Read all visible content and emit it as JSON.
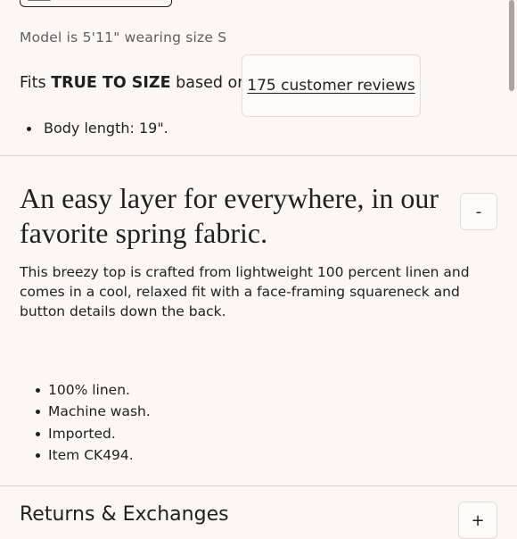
{
  "size_section": {
    "model_note": "Model is 5'11\" wearing size S",
    "fit_prefix": "Fits",
    "fit_value": "TRUE TO SIZE",
    "fit_middle": "based on",
    "reviews_link": "175 customer reviews",
    "details": [
      "Body length: 19\"."
    ]
  },
  "description_section": {
    "title": "An easy layer for everywhere, in our favorite spring fabric.",
    "toggle_label": "-",
    "body": "This breezy top is crafted from lightweight 100 percent linen and comes in a cool, relaxed fit with a face-framing squareneck and button details down the back.",
    "features": [
      "100% linen.",
      "Machine wash.",
      "Imported.",
      "Item CK494."
    ]
  },
  "returns_section": {
    "title": "Returns & Exchanges",
    "toggle_label": "+"
  },
  "icons": {
    "size_chip": "ruler-icon"
  },
  "colors": {
    "background": "#fcf7f3",
    "text": "#1f1f1f",
    "muted_text": "#5e5e5e",
    "divider": "#d9d3ce"
  }
}
